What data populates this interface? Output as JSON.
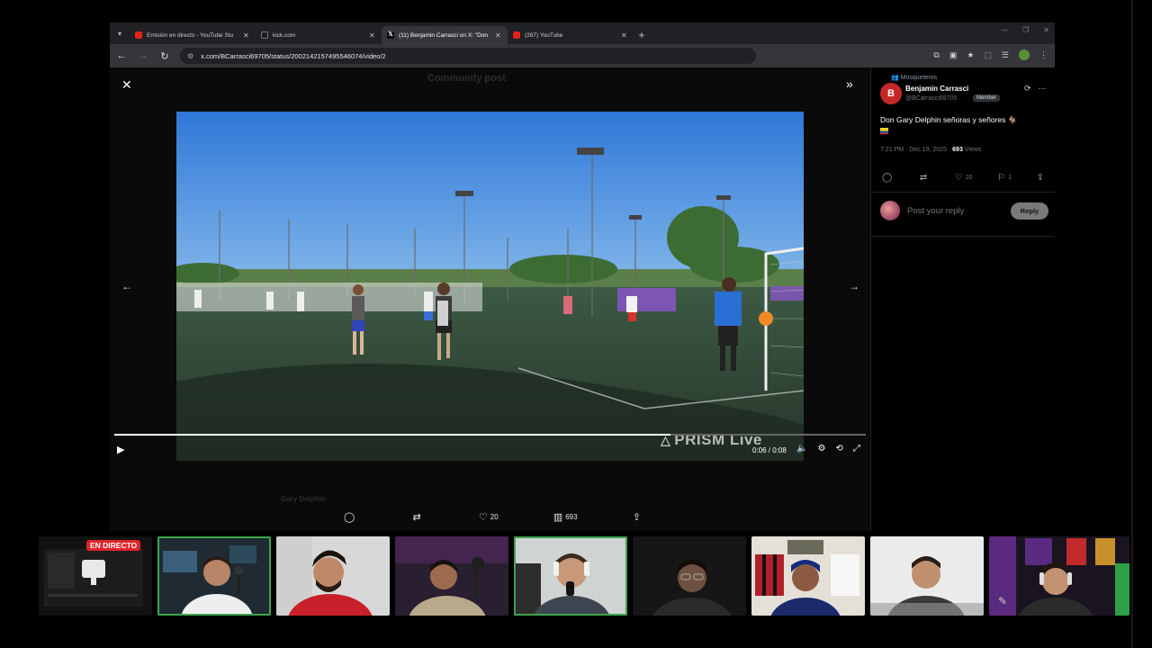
{
  "browser": {
    "tabs": [
      {
        "title": "Emisión en directo - YouTube Stu",
        "icon": "youtube-icon",
        "active": false
      },
      {
        "title": "kick.com",
        "icon": "kick-icon",
        "active": false
      },
      {
        "title": "(11) Benjamin Carrasci on X: \"Don",
        "icon": "x-icon",
        "active": true
      },
      {
        "title": "(287) YouTube",
        "icon": "youtube-icon",
        "active": false
      }
    ],
    "url": "x.com/BCarrasci69705/status/2002142157495546074/video/2"
  },
  "media": {
    "ghost_title": "Community post",
    "ghost_user": "Gary Delphin",
    "watermark": "PRISM Live",
    "progress": 0.74,
    "timecode": "0:06 / 0:08",
    "actions": {
      "replies": "",
      "reposts": "",
      "likes": "20",
      "views": "693"
    }
  },
  "tweet": {
    "community": "Mosqueteros",
    "avatar_letter": "B",
    "name": "Benjamin Carrasci",
    "handle": "@BCarrasci69705",
    "badge": "Member",
    "text": "Don Gary Delphin señoras y señores 🐐",
    "time": "7:21 PM · Dec 19, 2025 · ",
    "views_count": "693",
    "views_label": " Views",
    "stats": {
      "replies": "",
      "reposts": "",
      "likes": "20",
      "bookmarks": "1"
    },
    "reply_placeholder": "Post your reply",
    "reply_button": "Reply"
  },
  "strip": {
    "live_badge": "EN DIRECTO"
  },
  "colors": {
    "speaking_outline": "#3fa34d",
    "live_red": "#e0242b",
    "youtube_red": "#e62117"
  }
}
